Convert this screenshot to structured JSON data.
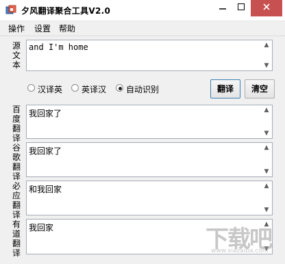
{
  "window": {
    "title": "夕风翻译聚合工具V2.0"
  },
  "menu": [
    "操作",
    "设置",
    "帮助"
  ],
  "source": {
    "label": "源文本",
    "value": "and I'm home"
  },
  "options": [
    {
      "label": "汉译英",
      "selected": false
    },
    {
      "label": "英译汉",
      "selected": false
    },
    {
      "label": "自动识别",
      "selected": true
    }
  ],
  "buttons": {
    "translate": "翻译",
    "clear": "清空"
  },
  "results": [
    {
      "label": "百度翻译",
      "value": "我回家了"
    },
    {
      "label": "谷歌翻译",
      "value": "我回家了"
    },
    {
      "label": "必应翻译",
      "value": "和我回家"
    },
    {
      "label": "有道翻译",
      "value": "我回家"
    }
  ],
  "watermark": {
    "text": "下载吧",
    "url": "www.xiazaiba.com"
  }
}
